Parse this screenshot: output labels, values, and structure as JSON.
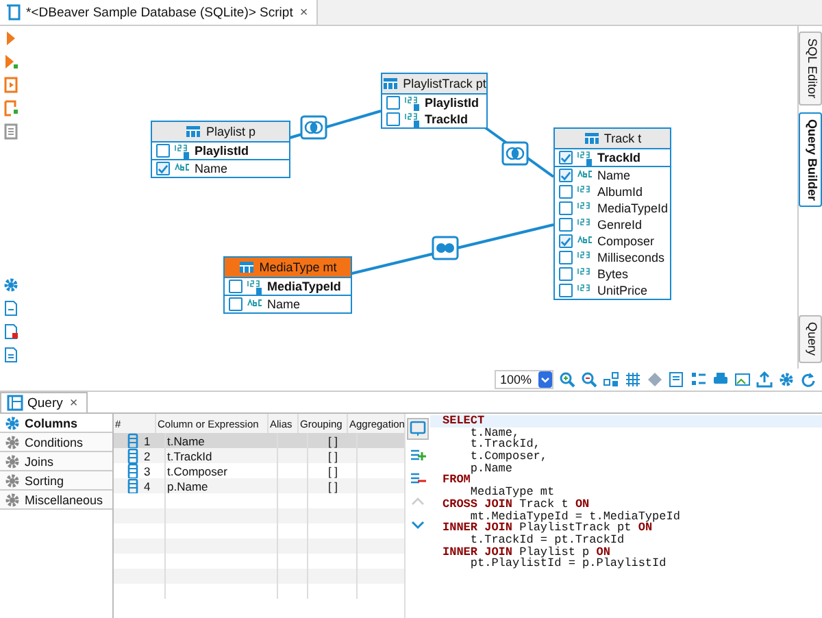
{
  "editor_tab": {
    "title": "*<DBeaver Sample Database (SQLite)> Script",
    "close": "×"
  },
  "side_tabs": [
    {
      "label": "SQL Editor",
      "selected": false
    },
    {
      "label": "Query Builder",
      "selected": true
    },
    {
      "label": "Query",
      "selected": false
    }
  ],
  "diagram": {
    "tables": [
      {
        "title": "Playlist p",
        "selected": false,
        "keys": [
          {
            "name": "PlaylistId",
            "kind": "number",
            "checked": false
          }
        ],
        "columns": [
          {
            "name": "Name",
            "kind": "text",
            "checked": true
          }
        ]
      },
      {
        "title": "PlaylistTrack pt",
        "selected": false,
        "keys": [
          {
            "name": "PlaylistId",
            "kind": "number",
            "checked": false
          },
          {
            "name": "TrackId",
            "kind": "number",
            "checked": false
          }
        ]
      },
      {
        "title": "Track t",
        "selected": false,
        "keys": [
          {
            "name": "TrackId",
            "kind": "number",
            "checked": true
          }
        ],
        "columns": [
          {
            "name": "Name",
            "kind": "text",
            "checked": true
          },
          {
            "name": "AlbumId",
            "kind": "number",
            "checked": false
          },
          {
            "name": "MediaTypeId",
            "kind": "number",
            "checked": false
          },
          {
            "name": "GenreId",
            "kind": "number",
            "checked": false
          },
          {
            "name": "Composer",
            "kind": "text",
            "checked": true
          },
          {
            "name": "Milliseconds",
            "kind": "number",
            "checked": false
          },
          {
            "name": "Bytes",
            "kind": "number",
            "checked": false
          },
          {
            "name": "UnitPrice",
            "kind": "number",
            "checked": false
          }
        ]
      },
      {
        "title": "MediaType mt",
        "selected": true,
        "keys": [
          {
            "name": "MediaTypeId",
            "kind": "number",
            "checked": false
          }
        ],
        "columns": [
          {
            "name": "Name",
            "kind": "text",
            "checked": false
          }
        ]
      }
    ],
    "joins": [
      {
        "kind": "inner"
      },
      {
        "kind": "inner"
      },
      {
        "kind": "cross"
      }
    ]
  },
  "zoom": "100%",
  "query_panel": {
    "tab": "Query",
    "close": "×",
    "sections": [
      {
        "label": "Columns",
        "selected": true
      },
      {
        "label": "Conditions",
        "selected": false
      },
      {
        "label": "Joins",
        "selected": false
      },
      {
        "label": "Sorting",
        "selected": false
      },
      {
        "label": "Miscellaneous",
        "selected": false
      }
    ],
    "columns_table": {
      "headers": [
        "#",
        "Column or Expression",
        "Alias",
        "Grouping",
        "Aggregation"
      ],
      "rows": [
        {
          "index": "1",
          "expression": "t.Name",
          "grouping": "[ ]",
          "selected": true
        },
        {
          "index": "2",
          "expression": "t.TrackId",
          "grouping": "[ ]",
          "selected": false
        },
        {
          "index": "3",
          "expression": "t.Composer",
          "grouping": "[ ]",
          "selected": false
        },
        {
          "index": "4",
          "expression": "p.Name",
          "grouping": "[ ]",
          "selected": false
        }
      ]
    },
    "sql": [
      [
        {
          "kind": "keyword",
          "text": "SELECT"
        }
      ],
      [
        {
          "kind": "plain",
          "text": "    t.Name,"
        }
      ],
      [
        {
          "kind": "plain",
          "text": "    t.TrackId,"
        }
      ],
      [
        {
          "kind": "plain",
          "text": "    t.Composer,"
        }
      ],
      [
        {
          "kind": "plain",
          "text": "    p.Name"
        }
      ],
      [
        {
          "kind": "keyword",
          "text": "FROM"
        }
      ],
      [
        {
          "kind": "plain",
          "text": "    MediaType mt"
        }
      ],
      [
        {
          "kind": "keyword",
          "text": "CROSS JOIN"
        },
        {
          "kind": "plain",
          "text": " Track t "
        },
        {
          "kind": "keyword",
          "text": "ON"
        }
      ],
      [
        {
          "kind": "plain",
          "text": "    mt.MediaTypeId = t.MediaTypeId"
        }
      ],
      [
        {
          "kind": "keyword",
          "text": "INNER JOIN"
        },
        {
          "kind": "plain",
          "text": " PlaylistTrack pt "
        },
        {
          "kind": "keyword",
          "text": "ON"
        }
      ],
      [
        {
          "kind": "plain",
          "text": "    t.TrackId = pt.TrackId"
        }
      ],
      [
        {
          "kind": "keyword",
          "text": "INNER JOIN"
        },
        {
          "kind": "plain",
          "text": " Playlist p "
        },
        {
          "kind": "keyword",
          "text": "ON"
        }
      ],
      [
        {
          "kind": "plain",
          "text": "    pt.PlaylistId = p.PlaylistId"
        }
      ]
    ]
  }
}
